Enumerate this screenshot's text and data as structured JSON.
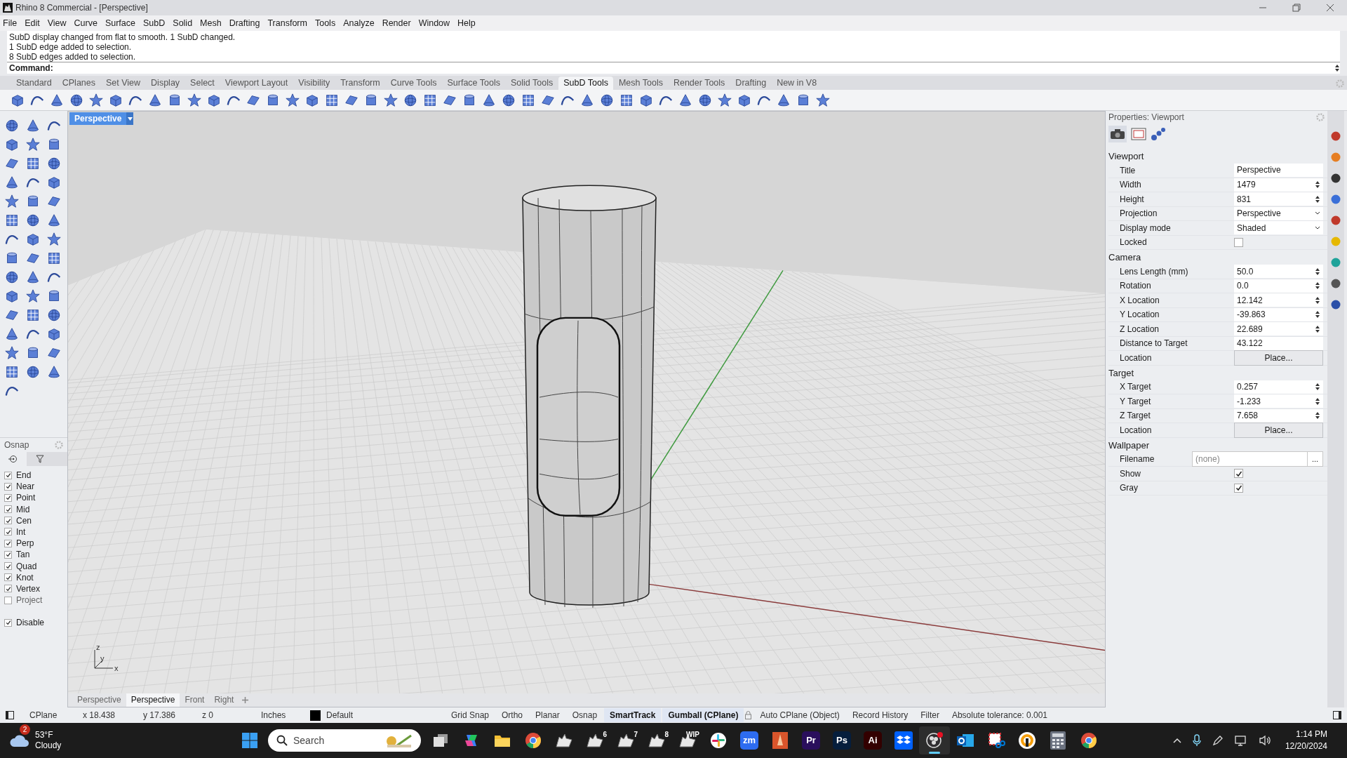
{
  "window": {
    "title": "Rhino 8 Commercial - [Perspective]"
  },
  "menu": [
    "File",
    "Edit",
    "View",
    "Curve",
    "Surface",
    "SubD",
    "Solid",
    "Mesh",
    "Drafting",
    "Transform",
    "Tools",
    "Analyze",
    "Render",
    "Window",
    "Help"
  ],
  "command_history": [
    "SubD display changed from flat to smooth. 1 SubD changed.",
    "1 SubD edge added to selection.",
    "8 SubD edges added to selection."
  ],
  "command_prompt": "Command:",
  "toolbar_tabs": [
    {
      "label": "Standard",
      "selected": false
    },
    {
      "label": "CPlanes",
      "selected": false
    },
    {
      "label": "Set View",
      "selected": false
    },
    {
      "label": "Display",
      "selected": false
    },
    {
      "label": "Select",
      "selected": false
    },
    {
      "label": "Viewport Layout",
      "selected": false
    },
    {
      "label": "Visibility",
      "selected": false
    },
    {
      "label": "Transform",
      "selected": false
    },
    {
      "label": "Curve Tools",
      "selected": false
    },
    {
      "label": "Surface Tools",
      "selected": false
    },
    {
      "label": "Solid Tools",
      "selected": false
    },
    {
      "label": "SubD Tools",
      "selected": true
    },
    {
      "label": "Mesh Tools",
      "selected": false
    },
    {
      "label": "Render Tools",
      "selected": false
    },
    {
      "label": "Drafting",
      "selected": false
    },
    {
      "label": "New in V8",
      "selected": false
    }
  ],
  "viewport": {
    "label": "Perspective",
    "axes": [
      "z",
      "y",
      "x"
    ]
  },
  "osnap": {
    "title": "Osnap",
    "items": [
      {
        "label": "End",
        "checked": true
      },
      {
        "label": "Near",
        "checked": true
      },
      {
        "label": "Point",
        "checked": true
      },
      {
        "label": "Mid",
        "checked": true
      },
      {
        "label": "Cen",
        "checked": true
      },
      {
        "label": "Int",
        "checked": true
      },
      {
        "label": "Perp",
        "checked": true
      },
      {
        "label": "Tan",
        "checked": true
      },
      {
        "label": "Quad",
        "checked": true
      },
      {
        "label": "Knot",
        "checked": true
      },
      {
        "label": "Vertex",
        "checked": true
      },
      {
        "label": "Project",
        "checked": false
      }
    ],
    "disable": {
      "label": "Disable",
      "checked": true
    }
  },
  "properties": {
    "title": "Properties: Viewport",
    "sections": [
      {
        "title": "Viewport",
        "rows": [
          {
            "kind": "text",
            "label": "Title",
            "value": "Perspective"
          },
          {
            "kind": "spin",
            "label": "Width",
            "value": "1479"
          },
          {
            "kind": "spin",
            "label": "Height",
            "value": "831"
          },
          {
            "kind": "dropdown",
            "label": "Projection",
            "value": "Perspective"
          },
          {
            "kind": "dropdown",
            "label": "Display mode",
            "value": "Shaded"
          },
          {
            "kind": "checkbox",
            "label": "Locked",
            "checked": false
          }
        ]
      },
      {
        "title": "Camera",
        "rows": [
          {
            "kind": "spin",
            "label": "Lens Length (mm)",
            "value": "50.0"
          },
          {
            "kind": "spin",
            "label": "Rotation",
            "value": "0.0"
          },
          {
            "kind": "spin",
            "label": "X Location",
            "value": "12.142"
          },
          {
            "kind": "spin",
            "label": "Y Location",
            "value": "-39.863"
          },
          {
            "kind": "spin",
            "label": "Z Location",
            "value": "22.689"
          },
          {
            "kind": "text",
            "label": "Distance to Target",
            "value": "43.122"
          },
          {
            "kind": "button",
            "label": "Location",
            "value": "Place..."
          }
        ]
      },
      {
        "title": "Target",
        "rows": [
          {
            "kind": "spin",
            "label": "X Target",
            "value": "0.257"
          },
          {
            "kind": "spin",
            "label": "Y Target",
            "value": "-1.233"
          },
          {
            "kind": "spin",
            "label": "Z Target",
            "value": "7.658"
          },
          {
            "kind": "button",
            "label": "Location",
            "value": "Place..."
          }
        ]
      },
      {
        "title": "Wallpaper",
        "rows": [
          {
            "kind": "file",
            "label": "Filename",
            "placeholder": "(none)",
            "button": "..."
          },
          {
            "kind": "checkbox",
            "label": "Show",
            "checked": true
          },
          {
            "kind": "checkbox",
            "label": "Gray",
            "checked": true
          }
        ]
      }
    ]
  },
  "viewport_tabs": [
    {
      "label": "Perspective",
      "selected": false
    },
    {
      "label": "Perspective",
      "selected": true
    },
    {
      "label": "Front",
      "selected": false
    },
    {
      "label": "Right",
      "selected": false
    }
  ],
  "status_bar": {
    "cplane": "CPlane",
    "x": "x 18.438",
    "y": "y 17.386",
    "z": "z 0",
    "units": "Inches",
    "layer": {
      "name": "Default",
      "color": "#000000"
    },
    "toggles": [
      {
        "label": "Grid Snap",
        "on": false,
        "kind": "plain"
      },
      {
        "label": "Ortho",
        "on": false,
        "kind": "plain"
      },
      {
        "label": "Planar",
        "on": false,
        "kind": "plain"
      },
      {
        "label": "Osnap",
        "on": false,
        "kind": "plain"
      },
      {
        "label": "SmartTrack",
        "on": true,
        "kind": "plain"
      },
      {
        "label": "Gumball (CPlane)",
        "on": true,
        "kind": "plain"
      },
      {
        "label": "Auto CPlane (Object)",
        "on": false,
        "kind": "lock"
      },
      {
        "label": "Record History",
        "on": false,
        "kind": "plain"
      },
      {
        "label": "Filter",
        "on": false,
        "kind": "plain"
      }
    ],
    "tolerance": "Absolute tolerance: 0.001"
  },
  "taskbar": {
    "weather": {
      "badge": "2",
      "temp": "53°F",
      "condition": "Cloudy"
    },
    "search": {
      "placeholder": "Search"
    },
    "apps": [
      {
        "kind": "taskview",
        "active": false
      },
      {
        "kind": "copilot",
        "active": false
      },
      {
        "kind": "folder",
        "active": false
      },
      {
        "kind": "chrome",
        "active": false
      },
      {
        "kind": "rhino",
        "active": false
      },
      {
        "kind": "rhino",
        "label": "6",
        "active": false
      },
      {
        "kind": "rhino",
        "label": "7",
        "active": false
      },
      {
        "kind": "rhino",
        "label": "8",
        "active": false
      },
      {
        "kind": "rhino",
        "label": "WIP",
        "active": false
      },
      {
        "kind": "slack",
        "active": false
      },
      {
        "kind": "letter",
        "label": "zm",
        "color": "#2d6cf0",
        "active": false
      },
      {
        "kind": "pencil",
        "active": false
      },
      {
        "kind": "letter",
        "label": "Pr",
        "color": "#2a0f5c",
        "active": false
      },
      {
        "kind": "letter",
        "label": "Ps",
        "color": "#061e3c",
        "active": false
      },
      {
        "kind": "letter",
        "label": "Ai",
        "color": "#330000",
        "active": false
      },
      {
        "kind": "dropbox",
        "active": false
      },
      {
        "kind": "obs",
        "active": true
      },
      {
        "kind": "outlook",
        "active": false
      },
      {
        "kind": "snip",
        "active": false
      },
      {
        "kind": "ring",
        "active": false
      },
      {
        "kind": "calculator",
        "active": false
      },
      {
        "kind": "chrome",
        "active": false
      }
    ],
    "time": "1:14 PM",
    "date": "12/20/2024"
  }
}
